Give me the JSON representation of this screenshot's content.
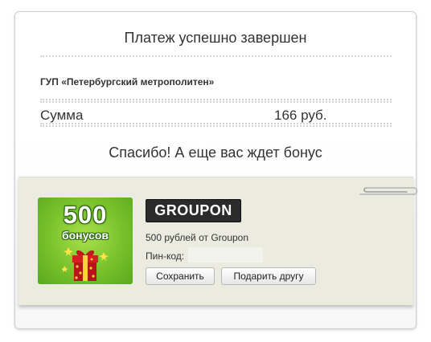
{
  "payment": {
    "title": "Платеж успешно завершен",
    "merchant": "ГУП «Петербургский метрополитен»",
    "sum_label": "Сумма",
    "sum_value": "166 руб."
  },
  "thanks": "Спасибо! А еще вас ждет бонус",
  "bonus": {
    "badge_number": "500",
    "badge_word": "бонусов",
    "logo_text": "GROUPON",
    "offer_text": "500 рублей от Groupon",
    "pin_label": "Пин-код:",
    "pin_value": "",
    "save_button": "Сохранить",
    "gift_button": "Подарить другу"
  },
  "colors": {
    "badge_green": "#79c22c",
    "panel_bg": "#ebecdf",
    "logo_bg": "#2b2b2b"
  }
}
